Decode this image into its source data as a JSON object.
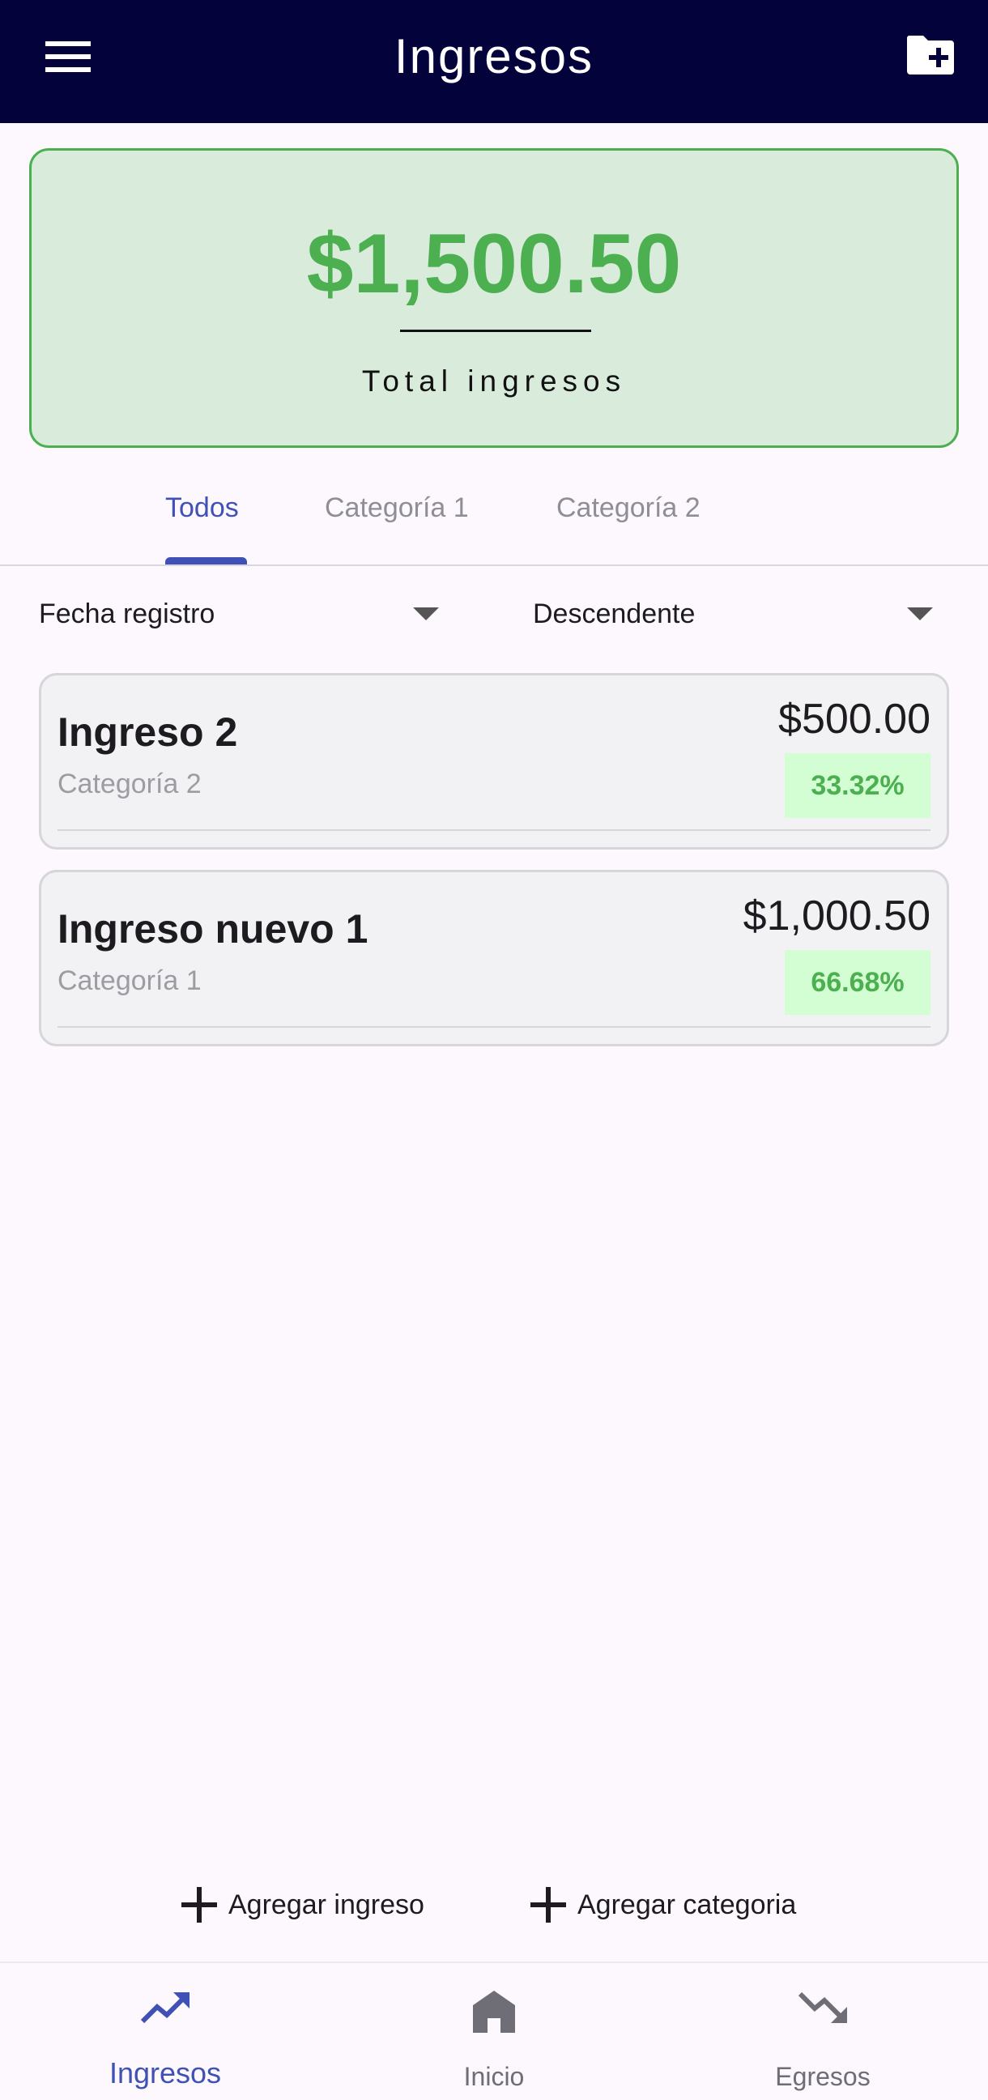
{
  "app_bar": {
    "title": "Ingresos",
    "menu_icon": "menu-icon",
    "action_icon": "folder-add-icon"
  },
  "summary": {
    "total_amount": "$1,500.50",
    "label": "Total ingresos",
    "accent_color": "#4caf50"
  },
  "tabs": [
    {
      "label": "Todos",
      "selected": true
    },
    {
      "label": "Categoría 1",
      "selected": false
    },
    {
      "label": "Categoría 2",
      "selected": false
    }
  ],
  "filters": {
    "sort_field": "Fecha registro",
    "sort_order": "Descendente"
  },
  "items": [
    {
      "name": "Ingreso 2",
      "category": "Categoría 2",
      "amount": "$500.00",
      "percent": "33.32%"
    },
    {
      "name": "Ingreso nuevo 1",
      "category": "Categoría 1",
      "amount": "$1,000.50",
      "percent": "66.68%"
    }
  ],
  "actions": {
    "add_income": "Agregar ingreso",
    "add_category": "Agregar categoria"
  },
  "bottom_nav": [
    {
      "label": "Ingresos",
      "icon": "trending-up-icon",
      "active": true
    },
    {
      "label": "Inicio",
      "icon": "home-icon",
      "active": false
    },
    {
      "label": "Egresos",
      "icon": "trending-down-icon",
      "active": false
    }
  ],
  "colors": {
    "app_bar": "#04023a",
    "primary": "#3f51b5",
    "income_green": "#4caf50"
  }
}
